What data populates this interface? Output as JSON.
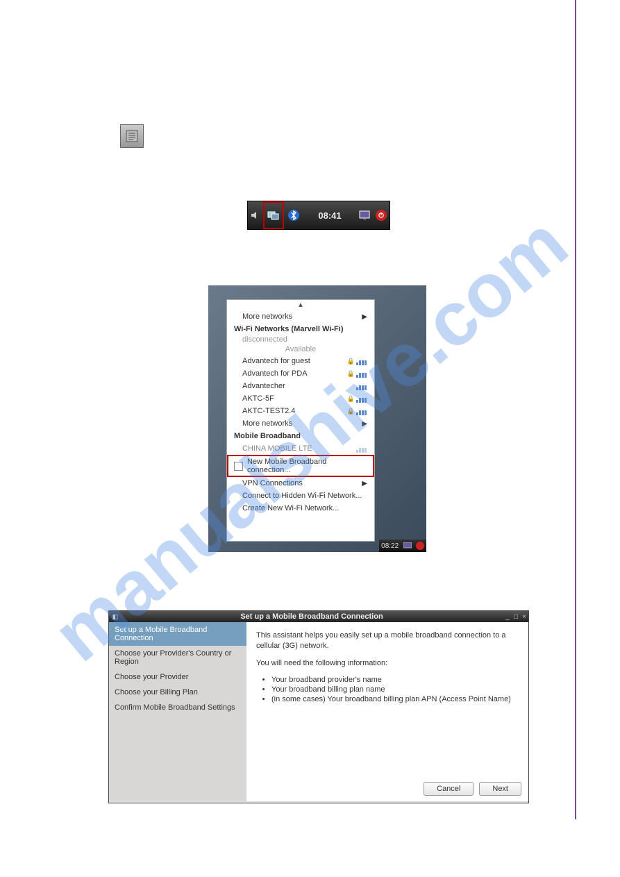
{
  "watermark": "manualshive.com",
  "tray1": {
    "time": "08:41"
  },
  "menu": {
    "more1": "More networks",
    "wifi_header": "Wi-Fi Networks (Marvell Wi-Fi)",
    "disconnected": "disconnected",
    "available": "Available",
    "nets": [
      "Advantech for guest",
      "Advantech for PDA",
      "Advantecher",
      "AKTC-5F",
      "AKTC-TEST2.4"
    ],
    "more2": "More networks",
    "mbb_header": "Mobile Broadband",
    "mbb_carrier": "CHINA MOBILE LTE",
    "mbb_new": "New Mobile Broadband connection...",
    "vpn": "VPN Connections",
    "hidden": "Connect to Hidden Wi-Fi Network...",
    "create": "Create New Wi-Fi Network...",
    "tray_time": "08:22"
  },
  "dlg": {
    "title": "Set up a Mobile Broadband Connection",
    "steps": [
      "Set up a Mobile Broadband Connection",
      "Choose your Provider's Country or Region",
      "Choose your Provider",
      "Choose your Billing Plan",
      "Confirm Mobile Broadband Settings"
    ],
    "intro": "This assistant helps you easily set up a mobile broadband connection to a cellular (3G) network.",
    "need": "You will need the following information:",
    "bullets": [
      "Your broadband provider's name",
      "Your broadband billing plan name",
      "(in some cases) Your broadband billing plan APN (Access Point Name)"
    ],
    "cancel": "Cancel",
    "next": "Next"
  }
}
